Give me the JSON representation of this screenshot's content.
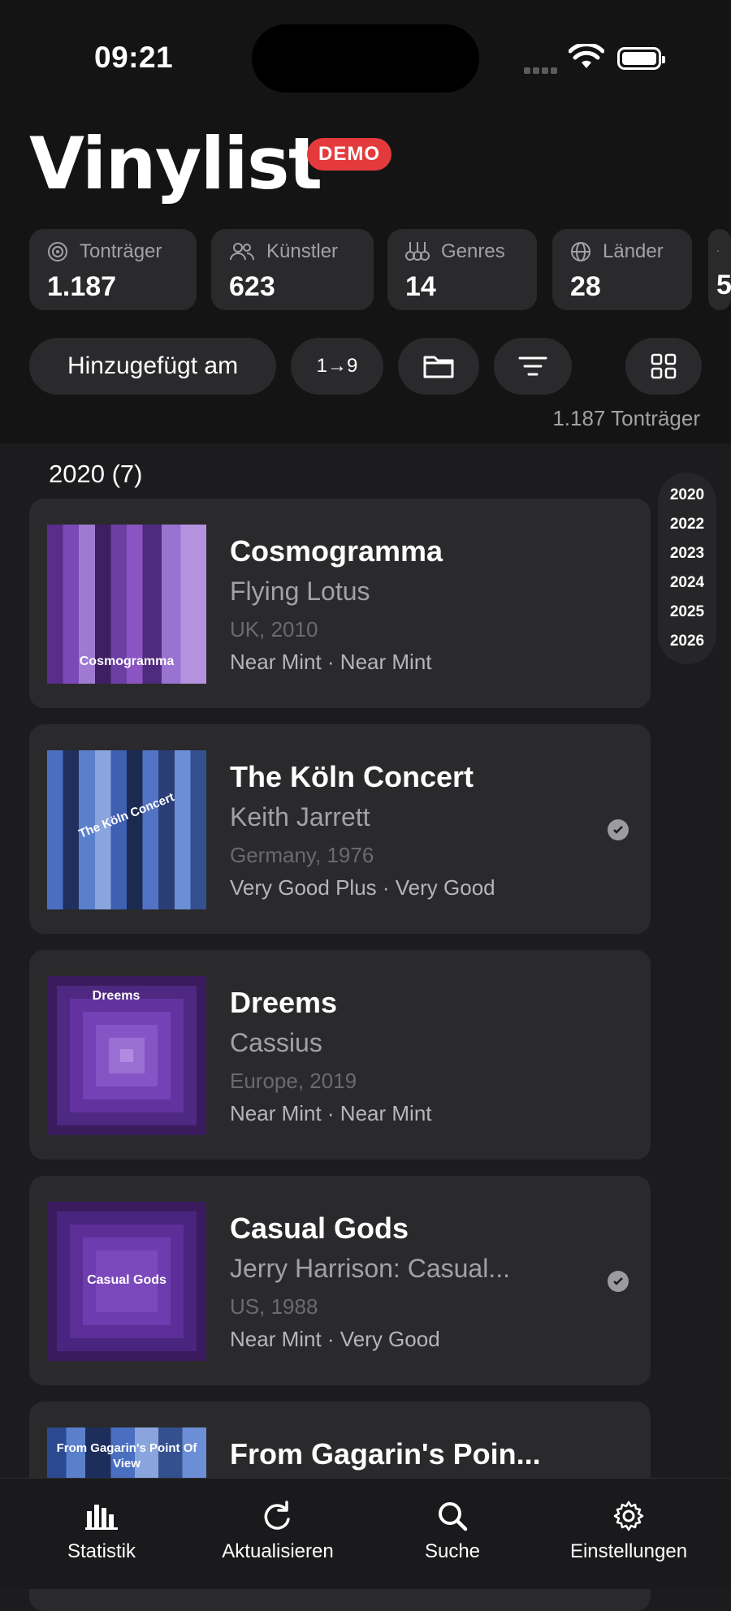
{
  "status_bar": {
    "time": "09:21"
  },
  "app": {
    "title": "Vinylist",
    "badge": "DEMO"
  },
  "stats": [
    {
      "icon": "record-icon",
      "label": "Tonträger",
      "value": "1.187"
    },
    {
      "icon": "people-icon",
      "label": "Künstler",
      "value": "623"
    },
    {
      "icon": "guitar-icon",
      "label": "Genres",
      "value": "14"
    },
    {
      "icon": "globe-icon",
      "label": "Länder",
      "value": "28"
    },
    {
      "icon": "tag-icon",
      "label": "",
      "value": "5"
    }
  ],
  "controls": {
    "sort_label": "Hinzugefügt am",
    "order_label": "1→9"
  },
  "count_text": "1.187 Tonträger",
  "section": {
    "header": "2020 (7)"
  },
  "year_index": [
    "2020",
    "2022",
    "2023",
    "2024",
    "2025",
    "2026"
  ],
  "records": [
    {
      "title": "Cosmogramma",
      "artist": "Flying Lotus",
      "origin": "UK, 2010",
      "condition": "Near Mint · Near Mint",
      "cover_text": "Cosmogramma",
      "owned": false
    },
    {
      "title": "The Köln Concert",
      "artist": "Keith Jarrett",
      "origin": "Germany, 1976",
      "condition": "Very Good Plus · Very Good",
      "cover_text": "The Köln Concert",
      "owned": true
    },
    {
      "title": "Dreems",
      "artist": "Cassius",
      "origin": "Europe, 2019",
      "condition": "Near Mint · Near Mint",
      "cover_text": "Dreems",
      "owned": false
    },
    {
      "title": "Casual Gods",
      "artist": "Jerry Harrison: Casual...",
      "origin": "US, 1988",
      "condition": "Near Mint · Very Good",
      "cover_text": "Casual Gods",
      "owned": true
    },
    {
      "title": "From Gagarin's Poin...",
      "artist": "",
      "origin": "",
      "condition": "",
      "cover_text": "From Gagarin's Point Of View",
      "owned": false
    }
  ],
  "tabs": [
    {
      "icon": "chart-icon",
      "label": "Statistik"
    },
    {
      "icon": "refresh-icon",
      "label": "Aktualisieren"
    },
    {
      "icon": "search-icon",
      "label": "Suche"
    },
    {
      "icon": "gear-icon",
      "label": "Einstellungen"
    }
  ],
  "colors": {
    "background": "#1c1c1e",
    "card": "#2a2a2c",
    "badge": "#e53a3d",
    "secondary_text": "#a2a2a6"
  }
}
